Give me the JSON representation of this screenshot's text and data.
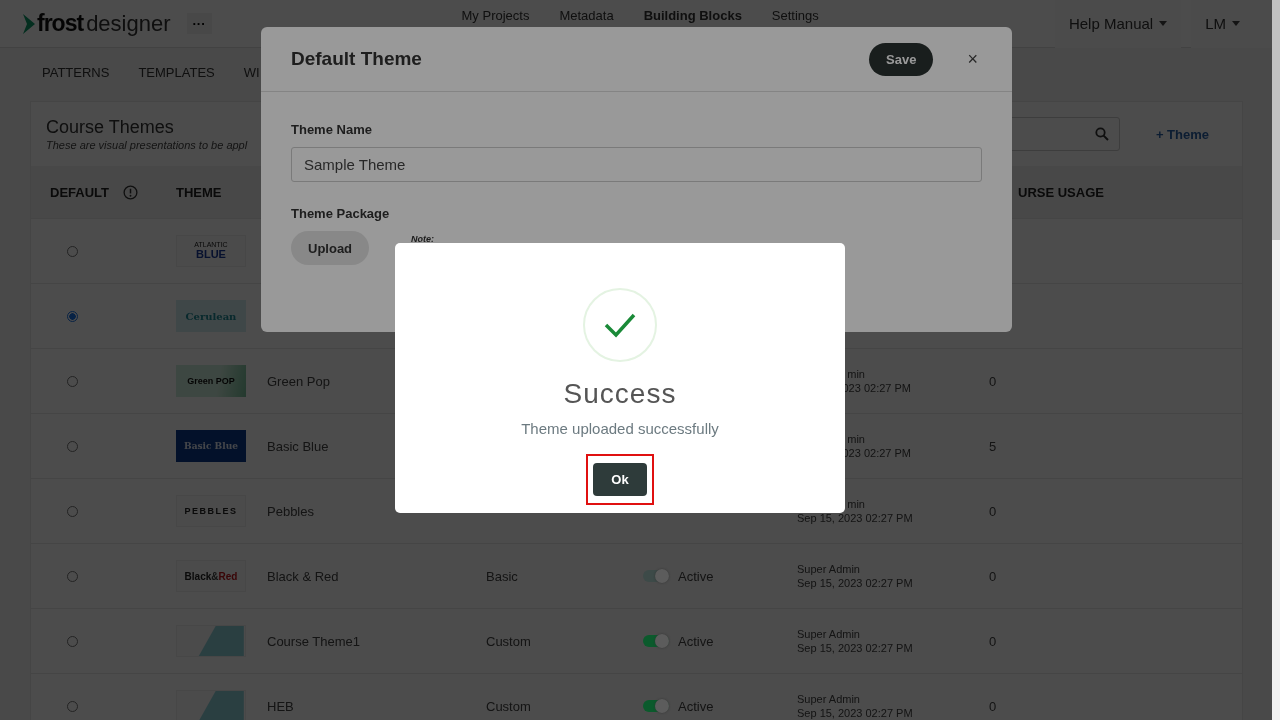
{
  "header": {
    "logo": {
      "bold": "frost",
      "light": "designer"
    },
    "more": "···",
    "nav": [
      {
        "label": "My Projects",
        "selected": false
      },
      {
        "label": "Metadata",
        "selected": false
      },
      {
        "label": "Building Blocks",
        "selected": true
      },
      {
        "label": "Settings",
        "selected": false
      }
    ],
    "help": "Help Manual",
    "user": "LM"
  },
  "subnav": [
    {
      "label": "PATTERNS"
    },
    {
      "label": "TEMPLATES"
    },
    {
      "label": "WI"
    }
  ],
  "card": {
    "title": "Course Themes",
    "subtitle": "These are visual presentations to be appl",
    "add_button": "+ Theme"
  },
  "table": {
    "columns": [
      "DEFAULT",
      "THEME",
      "URSE USAGE"
    ],
    "rows": [
      {
        "default": false,
        "thumb": {
          "kind": "stacked",
          "lines": [
            "ATLANTIC",
            "BLUE"
          ]
        }
      },
      {
        "default": true,
        "thumb": {
          "kind": "teal",
          "lines": [
            "Cerulean"
          ]
        }
      },
      {
        "default": false,
        "thumb": {
          "kind": "green",
          "lines": [
            "Green POP"
          ]
        },
        "name": "Green Pop",
        "creator": [
          {
            "text": "min",
            "cut": true
          },
          {
            "text": "023 02:27 PM",
            "cut": true
          }
        ],
        "usage": "0"
      },
      {
        "default": false,
        "thumb": {
          "kind": "navy",
          "lines": [
            "Basic Blue"
          ]
        },
        "name": "Basic Blue",
        "creator": [
          {
            "text": "min",
            "cut": true
          },
          {
            "text": "023 02:27 PM",
            "cut": true
          }
        ],
        "usage": "5"
      },
      {
        "default": false,
        "thumb": {
          "kind": "spaced",
          "lines": [
            "PEBBLES"
          ]
        },
        "name": "Pebbles",
        "creator": [
          {
            "text": "min",
            "cut": true
          },
          {
            "text": "Sep 15, 2023 02:27 PM",
            "cut": false
          }
        ],
        "usage": "0"
      },
      {
        "default": false,
        "thumb": {
          "kind": "duo",
          "lines": [
            "Black",
            "&",
            "Red"
          ]
        },
        "name": "Black & Red",
        "type": "Basic",
        "status": {
          "label": "Active",
          "on": true,
          "color": "#3d4a48"
        },
        "creator": [
          {
            "text": "Super Admin",
            "cut": false
          },
          {
            "text": "Sep 15, 2023 02:27 PM",
            "cut": false
          }
        ],
        "usage": "0"
      },
      {
        "default": false,
        "thumb": {
          "kind": "shape"
        },
        "name": "Course Theme1",
        "type": "Custom",
        "status": {
          "label": "Active",
          "on": true,
          "color": "#0b5a2c"
        },
        "creator": [
          {
            "text": "Super Admin",
            "cut": false
          },
          {
            "text": "Sep 15, 2023 02:27 PM",
            "cut": false
          }
        ],
        "usage": "0"
      },
      {
        "default": false,
        "thumb": {
          "kind": "shape"
        },
        "name": "HEB",
        "type": "Custom",
        "status": {
          "label": "Active",
          "on": true,
          "color": "#0b5a2c"
        },
        "creator": [
          {
            "text": "Super Admin",
            "cut": false
          },
          {
            "text": "Sep 15, 2023 02:27 PM",
            "cut": false
          }
        ],
        "usage": "0"
      }
    ]
  },
  "modal": {
    "title": "Default Theme",
    "save": "Save",
    "close": "×",
    "name_label": "Theme Name",
    "name_value": "Sample Theme",
    "package_label": "Theme Package",
    "upload": "Upload",
    "note": "Note:"
  },
  "dialog": {
    "title": "Success",
    "message": "Theme uploaded successfully",
    "ok": "Ok",
    "ok_highlighted": true
  }
}
